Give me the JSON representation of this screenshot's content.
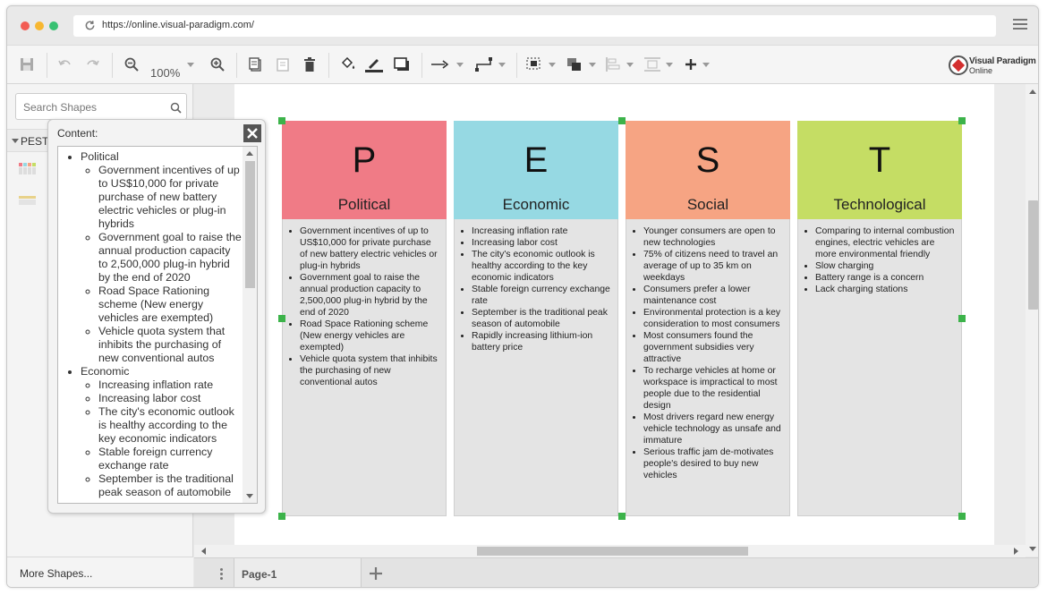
{
  "browser": {
    "url": "https://online.visual-paradigm.com/"
  },
  "toolbar": {
    "zoom": "100%",
    "logo_line1": "Visual Paradigm",
    "logo_line2": "Online"
  },
  "left_panel": {
    "search_placeholder": "Search Shapes",
    "category": "PEST",
    "more_shapes": "More Shapes..."
  },
  "popup": {
    "label": "Content:",
    "sections": [
      {
        "title": "Political",
        "items": [
          "Government incentives of up to US$10,000 for private purchase of new battery electric vehicles or plug-in hybrids",
          "Government goal to raise the annual production capacity to 2,500,000 plug-in hybrid by the end of 2020",
          "Road Space Rationing scheme (New energy vehicles are exempted)",
          "Vehicle quota system that inhibits the purchasing of new conventional autos"
        ]
      },
      {
        "title": "Economic",
        "items": [
          "Increasing inflation rate",
          "Increasing labor cost",
          "The city's economic outlook is healthy according to the key economic indicators",
          "Stable foreign currency exchange rate",
          "September is the traditional peak season of automobile"
        ]
      }
    ]
  },
  "pest": {
    "columns": [
      {
        "letter": "P",
        "title": "Political",
        "color": "#f07b86",
        "items": [
          "Government incentives of up to US$10,000 for private purchase of new battery electric vehicles or plug-in hybrids",
          "Government goal to raise the annual production capacity to 2,500,000 plug-in hybrid by the end of 2020",
          "Road Space Rationing scheme (New energy vehicles are exempted)",
          "Vehicle quota system that inhibits the purchasing of new conventional autos"
        ]
      },
      {
        "letter": "E",
        "title": "Economic",
        "color": "#96d9e3",
        "items": [
          "Increasing inflation rate",
          "Increasing labor cost",
          "The city's economic outlook is healthy according to the key economic indicators",
          "Stable foreign currency exchange rate",
          "September is the traditional peak season of automobile",
          "Rapidly increasing lithium-ion battery price"
        ]
      },
      {
        "letter": "S",
        "title": "Social",
        "color": "#f6a483",
        "items": [
          "Younger consumers are open to new technologies",
          "75% of citizens need to travel an average of up to 35 km on weekdays",
          "Consumers prefer a lower maintenance cost",
          "Environmental protection is a key consideration to most consumers",
          "Most consumers found the government subsidies very attractive",
          "To recharge vehicles at home or workspace is impractical to most people due to the residential design",
          "Most drivers regard new energy vehicle technology as unsafe and immature",
          "Serious traffic jam de-motivates people's desired to buy new vehicles"
        ]
      },
      {
        "letter": "T",
        "title": "Technological",
        "color": "#c5dd64",
        "items": [
          "Comparing to internal combustion engines, electric vehicles are more environmental friendly",
          "Slow charging",
          "Battery range is a concern",
          "Lack charging stations"
        ]
      }
    ]
  },
  "pages": {
    "tabs": [
      "Page-1"
    ]
  }
}
